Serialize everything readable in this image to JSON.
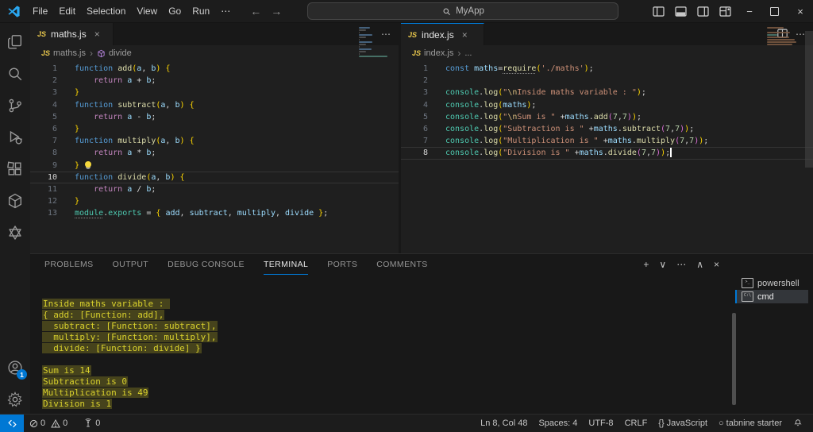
{
  "title_bar": {
    "menus": [
      "File",
      "Edit",
      "Selection",
      "View",
      "Go",
      "Run"
    ],
    "menu_overflow": "⋯",
    "back": "←",
    "forward": "→",
    "search_value": "MyApp",
    "window_buttons": {
      "minimize": "−",
      "close": "×"
    }
  },
  "icons": {
    "js_label": "JS",
    "more": "⋯",
    "plus": "+",
    "chevron_down": "∨",
    "chevron_up": "∧",
    "close": "×",
    "breadcrumb_sep": "›"
  },
  "activity_bar": {
    "top": [
      {
        "name": "explorer"
      },
      {
        "name": "search"
      },
      {
        "name": "source-control"
      },
      {
        "name": "run-debug"
      },
      {
        "name": "extensions"
      },
      {
        "name": "package"
      },
      {
        "name": "openai"
      }
    ],
    "bottom": [
      {
        "name": "account",
        "badge": "1"
      },
      {
        "name": "settings"
      }
    ]
  },
  "editors": [
    {
      "tab": {
        "label": "maths.js"
      },
      "focused": false,
      "breadcrumb": [
        {
          "icon": "js",
          "label": "maths.js"
        },
        {
          "icon": "symbol",
          "label": "divide"
        }
      ],
      "lines": [
        {
          "n": 1,
          "segs": [
            [
              "kw",
              "function "
            ],
            [
              "fn",
              "add"
            ],
            [
              "b1",
              "("
            ],
            [
              "vr",
              "a"
            ],
            [
              "pl",
              ", "
            ],
            [
              "vr",
              "b"
            ],
            [
              "b1",
              ")"
            ],
            [
              "pl",
              " "
            ],
            [
              "b1",
              "{"
            ]
          ]
        },
        {
          "n": 2,
          "segs": [
            [
              "ind",
              ""
            ],
            [
              "ret",
              "return "
            ],
            [
              "vr",
              "a"
            ],
            [
              "pl",
              " "
            ],
            [
              "op",
              "+"
            ],
            [
              "pl",
              " "
            ],
            [
              "vr",
              "b"
            ],
            [
              "pl",
              ";"
            ]
          ]
        },
        {
          "n": 3,
          "segs": [
            [
              "b1",
              "}"
            ]
          ]
        },
        {
          "n": 4,
          "segs": [
            [
              "kw",
              "function "
            ],
            [
              "fn",
              "subtract"
            ],
            [
              "b1",
              "("
            ],
            [
              "vr",
              "a"
            ],
            [
              "pl",
              ", "
            ],
            [
              "vr",
              "b"
            ],
            [
              "b1",
              ")"
            ],
            [
              "pl",
              " "
            ],
            [
              "b1",
              "{"
            ]
          ]
        },
        {
          "n": 5,
          "segs": [
            [
              "ind",
              ""
            ],
            [
              "ret",
              "return "
            ],
            [
              "vr",
              "a"
            ],
            [
              "pl",
              " "
            ],
            [
              "op",
              "-"
            ],
            [
              "pl",
              " "
            ],
            [
              "vr",
              "b"
            ],
            [
              "pl",
              ";"
            ]
          ]
        },
        {
          "n": 6,
          "segs": [
            [
              "b1",
              "}"
            ]
          ]
        },
        {
          "n": 7,
          "segs": [
            [
              "kw",
              "function "
            ],
            [
              "fn",
              "multiply"
            ],
            [
              "b1",
              "("
            ],
            [
              "vr",
              "a"
            ],
            [
              "pl",
              ", "
            ],
            [
              "vr",
              "b"
            ],
            [
              "b1",
              ")"
            ],
            [
              "pl",
              " "
            ],
            [
              "b1",
              "{"
            ]
          ]
        },
        {
          "n": 8,
          "segs": [
            [
              "ind",
              ""
            ],
            [
              "ret",
              "return "
            ],
            [
              "vr",
              "a"
            ],
            [
              "pl",
              " "
            ],
            [
              "op",
              "*"
            ],
            [
              "pl",
              " "
            ],
            [
              "vr",
              "b"
            ],
            [
              "pl",
              ";"
            ]
          ]
        },
        {
          "n": 9,
          "segs": [
            [
              "b1",
              "}"
            ],
            [
              "bulb",
              ""
            ]
          ]
        },
        {
          "n": 10,
          "active": true,
          "segs": [
            [
              "kw",
              "function "
            ],
            [
              "fn",
              "divide"
            ],
            [
              "b1",
              "("
            ],
            [
              "vr",
              "a"
            ],
            [
              "pl",
              ", "
            ],
            [
              "vr",
              "b"
            ],
            [
              "b1",
              ")"
            ],
            [
              "pl",
              " "
            ],
            [
              "b1",
              "{"
            ]
          ]
        },
        {
          "n": 11,
          "segs": [
            [
              "ind",
              ""
            ],
            [
              "ret",
              "return "
            ],
            [
              "vr",
              "a"
            ],
            [
              "pl",
              " "
            ],
            [
              "op",
              "/"
            ],
            [
              "pl",
              " "
            ],
            [
              "vr",
              "b"
            ],
            [
              "pl",
              ";"
            ]
          ]
        },
        {
          "n": 12,
          "segs": [
            [
              "b1",
              "}"
            ]
          ]
        },
        {
          "n": 13,
          "segs": [
            [
              "cld",
              "module"
            ],
            [
              "pl",
              "."
            ],
            [
              "cl",
              "exports"
            ],
            [
              "pl",
              " "
            ],
            [
              "op",
              "="
            ],
            [
              "pl",
              " "
            ],
            [
              "b1",
              "{"
            ],
            [
              "pl",
              " "
            ],
            [
              "vr",
              "add"
            ],
            [
              "pl",
              ", "
            ],
            [
              "vr",
              "subtract"
            ],
            [
              "pl",
              ", "
            ],
            [
              "vr",
              "multiply"
            ],
            [
              "pl",
              ", "
            ],
            [
              "vr",
              "divide"
            ],
            [
              "pl",
              " "
            ],
            [
              "b1",
              "}"
            ],
            [
              "pl",
              ";"
            ]
          ]
        }
      ]
    },
    {
      "tab": {
        "label": "index.js"
      },
      "focused": true,
      "breadcrumb": [
        {
          "icon": "js",
          "label": "index.js"
        },
        {
          "icon": null,
          "label": "..."
        }
      ],
      "lines": [
        {
          "n": 1,
          "segs": [
            [
              "kw",
              "const "
            ],
            [
              "vr",
              "maths"
            ],
            [
              "op",
              "="
            ],
            [
              "fnd",
              "require"
            ],
            [
              "b1",
              "("
            ],
            [
              "st",
              "'./maths'"
            ],
            [
              "b1",
              ")"
            ],
            [
              "pl",
              ";"
            ]
          ]
        },
        {
          "n": 2,
          "segs": []
        },
        {
          "n": 3,
          "segs": [
            [
              "cl",
              "console"
            ],
            [
              "pl",
              "."
            ],
            [
              "fn",
              "log"
            ],
            [
              "b1",
              "("
            ],
            [
              "st",
              "\""
            ],
            [
              "es",
              "\\n"
            ],
            [
              "st",
              "Inside maths variable : \""
            ],
            [
              "b1",
              ")"
            ],
            [
              "pl",
              ";"
            ]
          ]
        },
        {
          "n": 4,
          "segs": [
            [
              "cl",
              "console"
            ],
            [
              "pl",
              "."
            ],
            [
              "fn",
              "log"
            ],
            [
              "b1",
              "("
            ],
            [
              "vr",
              "maths"
            ],
            [
              "b1",
              ")"
            ],
            [
              "pl",
              ";"
            ]
          ]
        },
        {
          "n": 5,
          "segs": [
            [
              "cl",
              "console"
            ],
            [
              "pl",
              "."
            ],
            [
              "fn",
              "log"
            ],
            [
              "b1",
              "("
            ],
            [
              "st",
              "\""
            ],
            [
              "es",
              "\\n"
            ],
            [
              "st",
              "Sum is \""
            ],
            [
              "pl",
              " "
            ],
            [
              "op",
              "+"
            ],
            [
              "vr",
              "maths"
            ],
            [
              "pl",
              "."
            ],
            [
              "fn",
              "add"
            ],
            [
              "b2",
              "("
            ],
            [
              "nu",
              "7"
            ],
            [
              "pl",
              ","
            ],
            [
              "nu",
              "7"
            ],
            [
              "b2",
              ")"
            ],
            [
              "b1",
              ")"
            ],
            [
              "pl",
              ";"
            ]
          ]
        },
        {
          "n": 6,
          "segs": [
            [
              "cl",
              "console"
            ],
            [
              "pl",
              "."
            ],
            [
              "fn",
              "log"
            ],
            [
              "b1",
              "("
            ],
            [
              "st",
              "\"Subtraction is \""
            ],
            [
              "pl",
              " "
            ],
            [
              "op",
              "+"
            ],
            [
              "vr",
              "maths"
            ],
            [
              "pl",
              "."
            ],
            [
              "fn",
              "subtract"
            ],
            [
              "b2",
              "("
            ],
            [
              "nu",
              "7"
            ],
            [
              "pl",
              ","
            ],
            [
              "nu",
              "7"
            ],
            [
              "b2",
              ")"
            ],
            [
              "b1",
              ")"
            ],
            [
              "pl",
              ";"
            ]
          ]
        },
        {
          "n": 7,
          "segs": [
            [
              "cl",
              "console"
            ],
            [
              "pl",
              "."
            ],
            [
              "fn",
              "log"
            ],
            [
              "b1",
              "("
            ],
            [
              "st",
              "\"Multiplication is \""
            ],
            [
              "pl",
              " "
            ],
            [
              "op",
              "+"
            ],
            [
              "vr",
              "maths"
            ],
            [
              "pl",
              "."
            ],
            [
              "fn",
              "multiply"
            ],
            [
              "b2",
              "("
            ],
            [
              "nu",
              "7"
            ],
            [
              "pl",
              ","
            ],
            [
              "nu",
              "7"
            ],
            [
              "b2",
              ")"
            ],
            [
              "b1",
              ")"
            ],
            [
              "pl",
              ";"
            ]
          ]
        },
        {
          "n": 8,
          "active": true,
          "segs": [
            [
              "cl",
              "console"
            ],
            [
              "pl",
              "."
            ],
            [
              "fn",
              "log"
            ],
            [
              "b1",
              "("
            ],
            [
              "st",
              "\"Division is \""
            ],
            [
              "pl",
              " "
            ],
            [
              "op",
              "+"
            ],
            [
              "vr",
              "maths"
            ],
            [
              "pl",
              "."
            ],
            [
              "fn",
              "divide"
            ],
            [
              "b2",
              "("
            ],
            [
              "nu",
              "7"
            ],
            [
              "pl",
              ","
            ],
            [
              "nu",
              "7"
            ],
            [
              "b2",
              ")"
            ],
            [
              "b1",
              ")"
            ],
            [
              "pl",
              ";"
            ],
            [
              "cur",
              ""
            ]
          ]
        }
      ]
    }
  ],
  "panel": {
    "tabs": [
      "PROBLEMS",
      "OUTPUT",
      "DEBUG CONSOLE",
      "TERMINAL",
      "PORTS",
      "COMMENTS"
    ],
    "active_tab": "TERMINAL",
    "terminal": {
      "lines": [
        {
          "t": "Inside maths variable : ",
          "hl": true
        },
        {
          "t": "{ add: [Function: add],",
          "hl": true
        },
        {
          "t": "  subtract: [Function: subtract],",
          "hl": true
        },
        {
          "t": "  multiply: [Function: multiply],",
          "hl": true
        },
        {
          "t": "  divide: [Function: divide] }",
          "hl": true
        },
        {
          "t": "",
          "hl": false
        },
        {
          "t": "Sum is 14",
          "hl": true
        },
        {
          "t": "Subtraction is 0",
          "hl": true
        },
        {
          "t": "Multiplication is 49",
          "hl": true
        },
        {
          "t": "Division is 1",
          "hl": true
        }
      ],
      "sessions": [
        {
          "icon": ">_",
          "label": "powershell",
          "active": false
        },
        {
          "icon": "C:\\",
          "label": "cmd",
          "active": true
        }
      ]
    }
  },
  "status_bar": {
    "errors": "0",
    "warnings": "0",
    "ports": "0",
    "right": [
      {
        "icon": null,
        "label": "Ln 8, Col 48"
      },
      {
        "icon": null,
        "label": "Spaces: 4"
      },
      {
        "icon": null,
        "label": "UTF-8"
      },
      {
        "icon": null,
        "label": "CRLF"
      },
      {
        "icon": "{}",
        "label": "JavaScript"
      },
      {
        "icon": "○",
        "label": "tabnine starter"
      },
      {
        "icon": "bell",
        "label": ""
      }
    ]
  },
  "colors": {
    "accent": "#0078d4",
    "editor_bg": "#1f1f1f",
    "panel_bg": "#181818",
    "terminal_yellow": "#d9d12d",
    "js_icon_yellow": "#e7c64c",
    "symbol_purple": "#b180d7"
  }
}
